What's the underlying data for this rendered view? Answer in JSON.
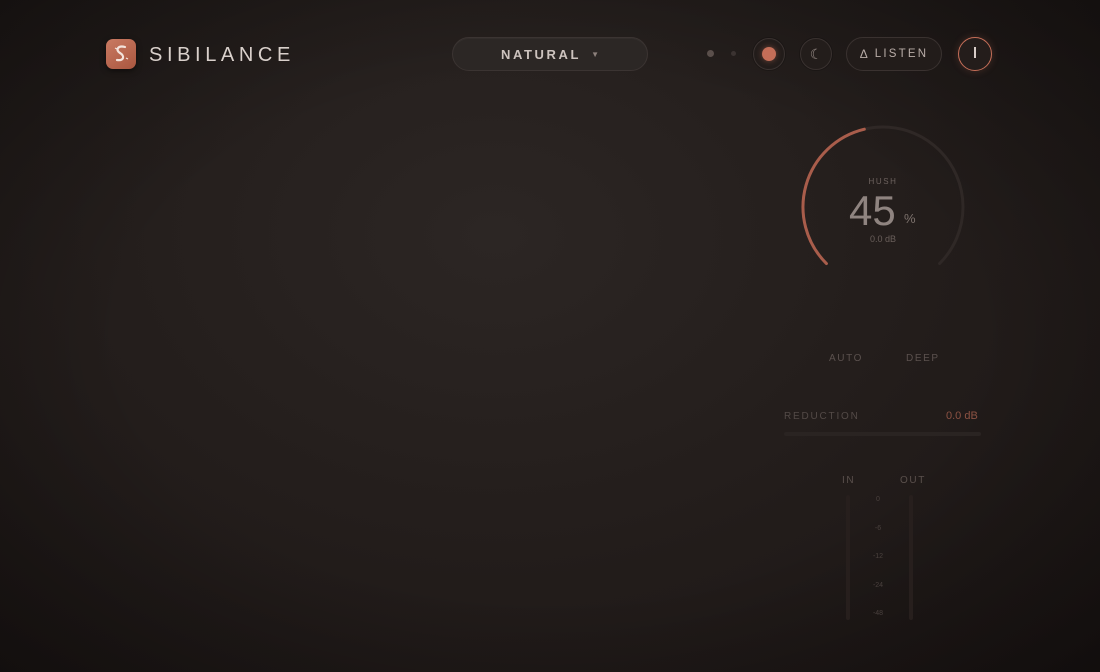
{
  "header": {
    "brand": "SIBILANCE",
    "preset": "NATURAL",
    "listen_label": "LISTEN"
  },
  "icons": {
    "logo": "s-waveform-logo-icon",
    "caret": "chevron-down-icon",
    "record": "record-dot-icon",
    "moon": "moon-icon",
    "listen": "delta-icon",
    "power": "power-icon"
  },
  "knob": {
    "title": "HUSH",
    "value": "45",
    "unit": "%",
    "db": "0.0 dB",
    "level": 0.45
  },
  "modes": {
    "auto": "AUTO",
    "deep": "DEEP"
  },
  "reduction": {
    "label": "REDUCTION",
    "value": "0.0 dB"
  },
  "meters": {
    "in_label": "IN",
    "out_label": "OUT",
    "ticks": [
      "0",
      "-6",
      "-12",
      "-24",
      "-48"
    ]
  },
  "colors": {
    "accent": "#c56e58",
    "background": "#241e1c"
  }
}
